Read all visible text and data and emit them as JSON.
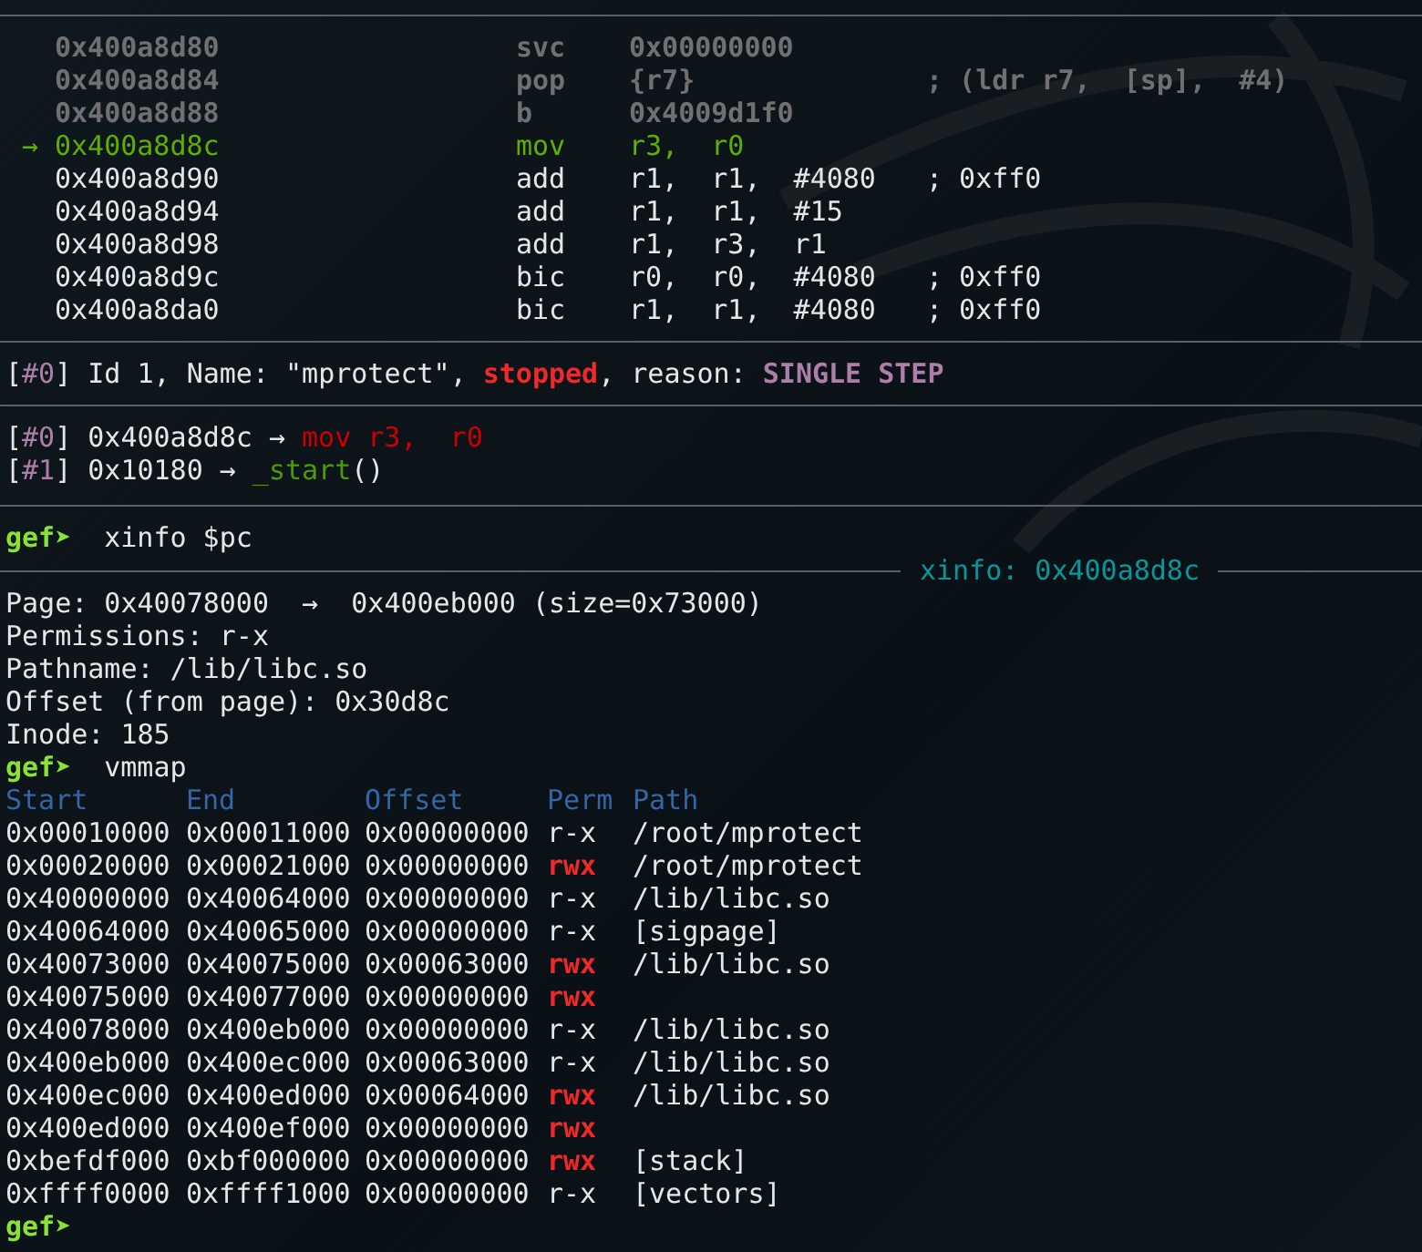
{
  "disassembly": [
    {
      "kind": "past",
      "address": "0x400a8d80",
      "mnemonic": "svc",
      "operands": "0x00000000"
    },
    {
      "kind": "past",
      "address": "0x400a8d84",
      "mnemonic": "pop",
      "operands": "{r7}",
      "comment": "; (ldr r7,  [sp],  #4)"
    },
    {
      "kind": "past",
      "address": "0x400a8d88",
      "mnemonic": "b",
      "operands": "0x4009d1f0"
    },
    {
      "kind": "current",
      "marker": "→",
      "address": "0x400a8d8c",
      "mnemonic": "mov",
      "operands": "r3,  r0"
    },
    {
      "kind": "future",
      "address": "0x400a8d90",
      "mnemonic": "add",
      "operands": "r1,  r1,  #4080",
      "comment": "; 0xff0"
    },
    {
      "kind": "future",
      "address": "0x400a8d94",
      "mnemonic": "add",
      "operands": "r1,  r1,  #15"
    },
    {
      "kind": "future",
      "address": "0x400a8d98",
      "mnemonic": "add",
      "operands": "r1,  r3,  r1"
    },
    {
      "kind": "future",
      "address": "0x400a8d9c",
      "mnemonic": "bic",
      "operands": "r0,  r0,  #4080",
      "comment": "; 0xff0"
    },
    {
      "kind": "future",
      "address": "0x400a8da0",
      "mnemonic": "bic",
      "operands": "r1,  r1,  #4080",
      "comment": "; 0xff0"
    }
  ],
  "thread": {
    "open": "[",
    "index": "#0",
    "close": "]",
    "info": "Id 1, Name: \"mprotect\",",
    "state": "stopped",
    "reason_label": ", reason:",
    "reason": "SINGLE STEP"
  },
  "frames": [
    {
      "open": "[",
      "index": "#0",
      "close": "]",
      "address": "0x400a8d8c",
      "arrow": "→",
      "kind": "instruction",
      "target": "mov r3,  r0"
    },
    {
      "open": "[",
      "index": "#1",
      "close": "]",
      "address": "0x10180",
      "arrow": "→",
      "kind": "function",
      "target": "_start",
      "suffix": "()"
    }
  ],
  "xinfo": {
    "prompt": "gef➤",
    "command": "xinfo $pc",
    "title": "xinfo: 0x400a8d8c",
    "lines": [
      "Page: 0x40078000  →  0x400eb000 (size=0x73000)",
      "Permissions: r-x",
      "Pathname: /lib/libc.so",
      "Offset (from page): 0x30d8c",
      "Inode: 185"
    ]
  },
  "vmmap": {
    "prompt": "gef➤",
    "command": "vmmap",
    "columns": [
      "Start",
      "End",
      "Offset",
      "Perm",
      "Path"
    ],
    "rows": [
      {
        "start": "0x00010000",
        "end": "0x00011000",
        "offset": "0x00000000",
        "perm": "r-x",
        "highlight": false,
        "path": "/root/mprotect"
      },
      {
        "start": "0x00020000",
        "end": "0x00021000",
        "offset": "0x00000000",
        "perm": "rwx",
        "highlight": true,
        "path": "/root/mprotect"
      },
      {
        "start": "0x40000000",
        "end": "0x40064000",
        "offset": "0x00000000",
        "perm": "r-x",
        "highlight": false,
        "path": "/lib/libc.so"
      },
      {
        "start": "0x40064000",
        "end": "0x40065000",
        "offset": "0x00000000",
        "perm": "r-x",
        "highlight": false,
        "path": "[sigpage]"
      },
      {
        "start": "0x40073000",
        "end": "0x40075000",
        "offset": "0x00063000",
        "perm": "rwx",
        "highlight": true,
        "path": "/lib/libc.so"
      },
      {
        "start": "0x40075000",
        "end": "0x40077000",
        "offset": "0x00000000",
        "perm": "rwx",
        "highlight": true
      },
      {
        "start": "0x40078000",
        "end": "0x400eb000",
        "offset": "0x00000000",
        "perm": "r-x",
        "highlight": false,
        "path": "/lib/libc.so"
      },
      {
        "start": "0x400eb000",
        "end": "0x400ec000",
        "offset": "0x00063000",
        "perm": "r-x",
        "highlight": false,
        "path": "/lib/libc.so"
      },
      {
        "start": "0x400ec000",
        "end": "0x400ed000",
        "offset": "0x00064000",
        "perm": "rwx",
        "highlight": true,
        "path": "/lib/libc.so"
      },
      {
        "start": "0x400ed000",
        "end": "0x400ef000",
        "offset": "0x00000000",
        "perm": "rwx",
        "highlight": true
      },
      {
        "start": "0xbefdf000",
        "end": "0xbf000000",
        "offset": "0x00000000",
        "perm": "rwx",
        "highlight": true,
        "path": "[stack]"
      },
      {
        "start": "0xffff0000",
        "end": "0xffff1000",
        "offset": "0x00000000",
        "perm": "r-x",
        "highlight": false,
        "path": "[vectors]"
      }
    ]
  },
  "final_prompt": "gef➤"
}
